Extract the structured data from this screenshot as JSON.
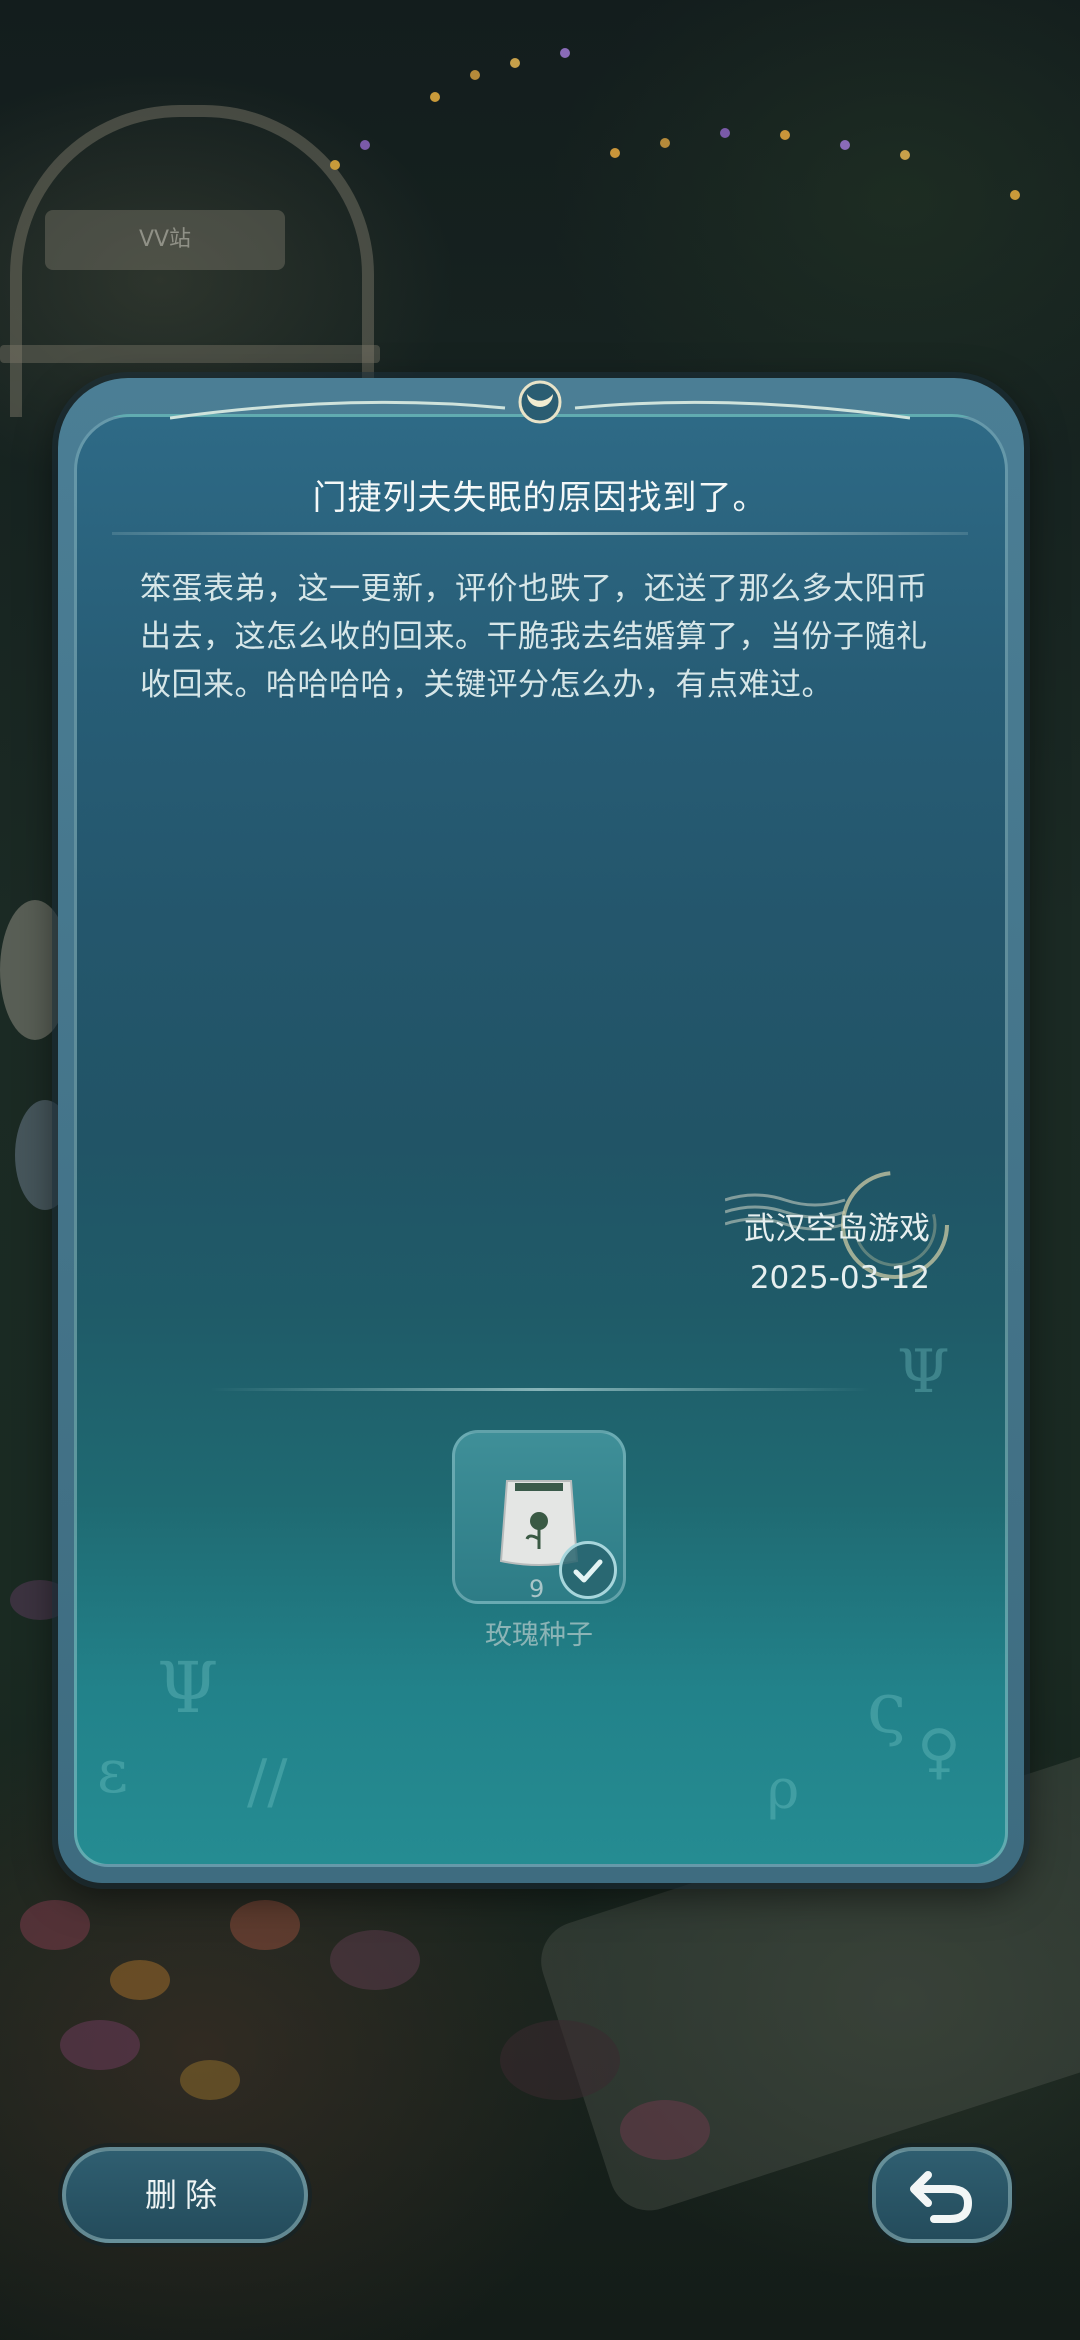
{
  "background": {
    "station_sign": "VV站"
  },
  "letter": {
    "title": "门捷列夫失眠的原因找到了。",
    "body": "笨蛋表弟，这一更新，评价也跌了，还送了那么多太阳币出去，这怎么收的回来。干脆我去结婚算了，当份子随礼收回来。哈哈哈哈，关键评分怎么办，有点难过。",
    "sender": "武汉空岛游戏",
    "date": "2025-03-12",
    "attachment": {
      "name": "玫瑰种子",
      "count": "9",
      "claimed_icon": "check-icon",
      "item_icon": "seed-bag-icon"
    }
  },
  "buttons": {
    "delete_label": "删除",
    "back_icon": "return-arrow-icon"
  },
  "colors": {
    "panel_top": "#2e6a86",
    "panel_bottom": "#258c92",
    "text": "#d6e6e8"
  }
}
